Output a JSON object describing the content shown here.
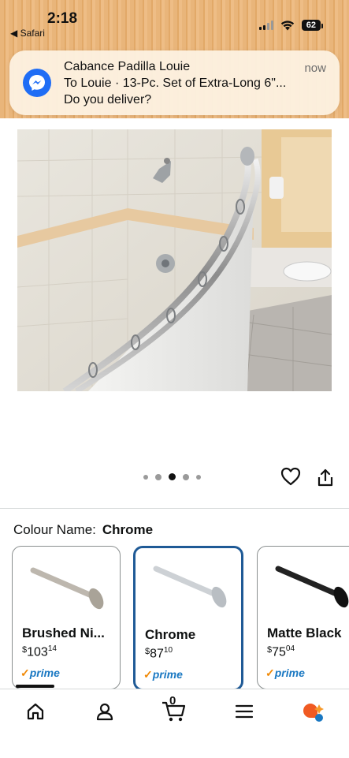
{
  "status_bar": {
    "time": "2:18",
    "back_label": "◀ Safari",
    "battery": "62"
  },
  "notification": {
    "app": "messenger-icon",
    "title": "Cabance Padilla Louie",
    "subtitle": "To Louie · 13-Pc. Set of Extra-Long 6\"...",
    "body": "Do you deliver?",
    "time": "now"
  },
  "gallery": {
    "image": "curved shower rod product photo",
    "dot_count": 5,
    "active_dot": 3
  },
  "colour": {
    "label": "Colour Name:",
    "selected": "Chrome"
  },
  "variants": [
    {
      "name": "Brushed Ni...",
      "currency": "$",
      "price_whole": "103",
      "price_frac": "14",
      "prime": "prime",
      "selected": false,
      "color": "#b8b4ac"
    },
    {
      "name": "Chrome",
      "currency": "$",
      "price_whole": "87",
      "price_frac": "10",
      "prime": "prime",
      "selected": true,
      "color": "#c8ccd0"
    },
    {
      "name": "Matte Black",
      "currency": "$",
      "price_whole": "75",
      "price_frac": "04",
      "prime": "prime",
      "selected": false,
      "color": "#222222"
    }
  ],
  "bottom_nav": {
    "items": [
      "home-icon",
      "account-icon",
      "cart-icon",
      "menu-icon",
      "rufus-icon"
    ],
    "cart_count": "0"
  },
  "colors": {
    "accent_blue": "#1f5a96",
    "prime_blue": "#1a78c2",
    "prime_check": "#f08804",
    "messenger": "#1f6df5"
  }
}
